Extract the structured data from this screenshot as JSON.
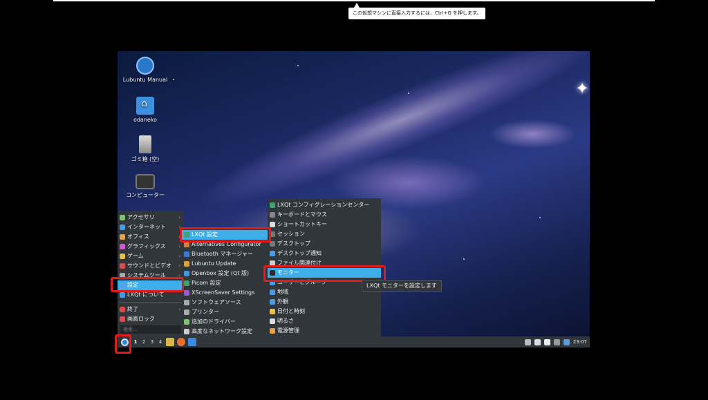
{
  "hint": {
    "text": "この仮想マシンに直接入力するには、Ctrl+G を押します。"
  },
  "desktop_icons": [
    {
      "label": "Lubuntu Manual",
      "icon": "manual-icon"
    },
    {
      "label": "odaneko",
      "icon": "home-folder-icon"
    },
    {
      "label": "ゴミ箱 (空)",
      "icon": "trash-icon"
    },
    {
      "label": "コンピューター",
      "icon": "computer-icon"
    }
  ],
  "menu_main": {
    "items": [
      {
        "label": "アクセサリ",
        "icon_color": "#7ec46a",
        "submenu": true
      },
      {
        "label": "インターネット",
        "icon_color": "#4a9be8",
        "submenu": true
      },
      {
        "label": "オフィス",
        "icon_color": "#e5a04a",
        "submenu": true
      },
      {
        "label": "グラフィックス",
        "icon_color": "#d05ad0",
        "submenu": true
      },
      {
        "label": "ゲーム",
        "icon_color": "#e8c04a",
        "submenu": true
      },
      {
        "label": "サウンドとビデオ",
        "icon_color": "#e04a4a",
        "submenu": true
      },
      {
        "label": "システムツール",
        "icon_color": "#aaaaaa",
        "submenu": true
      },
      {
        "label": "設定",
        "icon_color": "#5aa0e8",
        "submenu": true,
        "highlighted": true
      },
      {
        "label": "LXQt について",
        "icon_color": "#3d9be9",
        "submenu": false
      }
    ],
    "bottom_items": [
      {
        "label": "終了",
        "icon_color": "#e04a4a",
        "submenu": true
      },
      {
        "label": "画面ロック",
        "icon_color": "#e04a4a",
        "submenu": false
      }
    ],
    "search_placeholder": "検索..."
  },
  "menu_settings": {
    "items": [
      {
        "label": "LXQt 設定",
        "icon_color": "#3ea36e",
        "submenu": true,
        "highlighted": true
      },
      {
        "label": "Alternatives Configurator",
        "icon_color": "#e07a3a"
      },
      {
        "label": "Bluetooth マネージャー",
        "icon_color": "#3a7ae0"
      },
      {
        "label": "Lubuntu Update",
        "icon_color": "#e0a03a"
      },
      {
        "label": "Openbox 設定 (Qt 版)",
        "icon_color": "#3a9ae0"
      },
      {
        "label": "Picom 設定",
        "icon_color": "#3ea36e"
      },
      {
        "label": "XScreenSaver Settings",
        "icon_color": "#9a5ad0"
      },
      {
        "label": "ソフトウェアソース",
        "icon_color": "#aaaaaa"
      },
      {
        "label": "プリンター",
        "icon_color": "#aaaaaa"
      },
      {
        "label": "追加のドライバー",
        "icon_color": "#7ec46a"
      },
      {
        "label": "高度なネットワーク設定",
        "icon_color": "#cccccc"
      }
    ]
  },
  "menu_lxqt": {
    "items": [
      {
        "label": "LXQt コンフィグレーションセンター",
        "icon_color": "#3ea36e"
      },
      {
        "label": "キーボードとマウス",
        "icon_color": "#888888"
      },
      {
        "label": "ショートカットキー",
        "icon_color": "#dddddd"
      },
      {
        "label": "セッション",
        "icon_color": "#777777"
      },
      {
        "label": "デスクトップ",
        "icon_color": "#777777"
      },
      {
        "label": "デスクトップ通知",
        "icon_color": "#4a9be8"
      },
      {
        "label": "ファイル関連付け",
        "icon_color": "#cccccc"
      },
      {
        "label": "モニター",
        "icon_color": "#2a2a2a",
        "highlighted": true
      },
      {
        "label": "ユーザーとグループ",
        "icon_color": "#4a9be8"
      },
      {
        "label": "地域",
        "icon_color": "#4a9be8"
      },
      {
        "label": "外観",
        "icon_color": "#4a9be8"
      },
      {
        "label": "日付と時刻",
        "icon_color": "#e8c04a"
      },
      {
        "label": "明るさ",
        "icon_color": "#dddddd"
      },
      {
        "label": "電源管理",
        "icon_color": "#e8a04a"
      }
    ]
  },
  "tooltip": {
    "text": "LXQt モニターを設定します"
  },
  "taskbar": {
    "workspaces": [
      "1",
      "2",
      "3",
      "4"
    ],
    "active_workspace": "1",
    "clock": "23:07"
  },
  "colors": {
    "highlight": "#3daee9",
    "annotation_red": "#e21b1b",
    "menu_bg": "#31363b"
  }
}
